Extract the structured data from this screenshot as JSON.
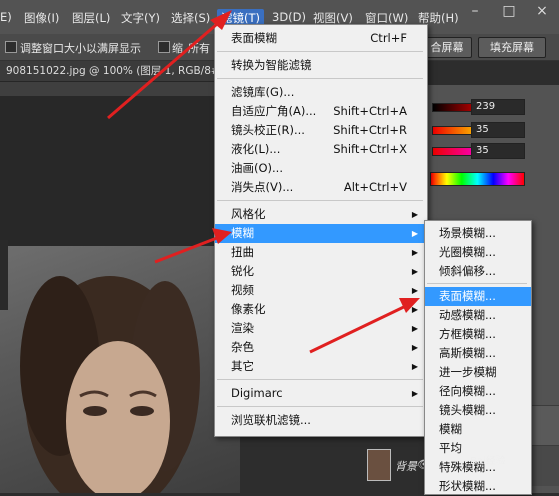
{
  "menubar": {
    "items": [
      "E)",
      "图像(I)",
      "图层(L)",
      "文字(Y)",
      "选择(S)",
      "滤镜(T)",
      "3D(D)",
      "视图(V)",
      "窗口(W)",
      "帮助(H)"
    ],
    "window_buttons": [
      "–",
      "□",
      "×"
    ]
  },
  "options": {
    "checkbox1_label": "调整窗口大小以满屏显示",
    "checkbox2_label": "缩",
    "checkbox2_suffix": "所有",
    "btn_fit": "合屏幕",
    "btn_fill": "填充屏幕"
  },
  "document_tab": "908151022.jpg @ 100% (图层 1, RGB/8#) *",
  "color_panel": {
    "values": [
      "239",
      "35",
      "35"
    ]
  },
  "filter_menu": {
    "items": [
      {
        "label": "表面模糊",
        "shortcut": "Ctrl+F"
      },
      {
        "label": "转换为智能滤镜",
        "shortcut": ""
      },
      {
        "label": "滤镜库(G)...",
        "shortcut": ""
      },
      {
        "label": "自适应广角(A)...",
        "shortcut": "Shift+Ctrl+A"
      },
      {
        "label": "镜头校正(R)...",
        "shortcut": "Shift+Ctrl+R"
      },
      {
        "label": "液化(L)...",
        "shortcut": "Shift+Ctrl+X"
      },
      {
        "label": "油画(O)...",
        "shortcut": ""
      },
      {
        "label": "消失点(V)...",
        "shortcut": "Alt+Ctrl+V"
      },
      {
        "label": "风格化",
        "shortcut": ""
      },
      {
        "label": "模糊",
        "shortcut": ""
      },
      {
        "label": "扭曲",
        "shortcut": ""
      },
      {
        "label": "锐化",
        "shortcut": ""
      },
      {
        "label": "视频",
        "shortcut": ""
      },
      {
        "label": "像素化",
        "shortcut": ""
      },
      {
        "label": "渲染",
        "shortcut": ""
      },
      {
        "label": "杂色",
        "shortcut": ""
      },
      {
        "label": "其它",
        "shortcut": ""
      },
      {
        "label": "Digimarc",
        "shortcut": ""
      },
      {
        "label": "浏览联机滤镜...",
        "shortcut": ""
      }
    ]
  },
  "blur_submenu": {
    "items": [
      "场景模糊...",
      "光圈模糊...",
      "倾斜偏移...",
      "表面模糊...",
      "动感模糊...",
      "方框模糊...",
      "高斯模糊...",
      "进一步模糊",
      "径向模糊...",
      "镜头模糊...",
      "模糊",
      "平均",
      "特殊模糊...",
      "形状模糊..."
    ]
  },
  "layers": {
    "layer_name": "背景"
  },
  "watermark": "Bai经验"
}
